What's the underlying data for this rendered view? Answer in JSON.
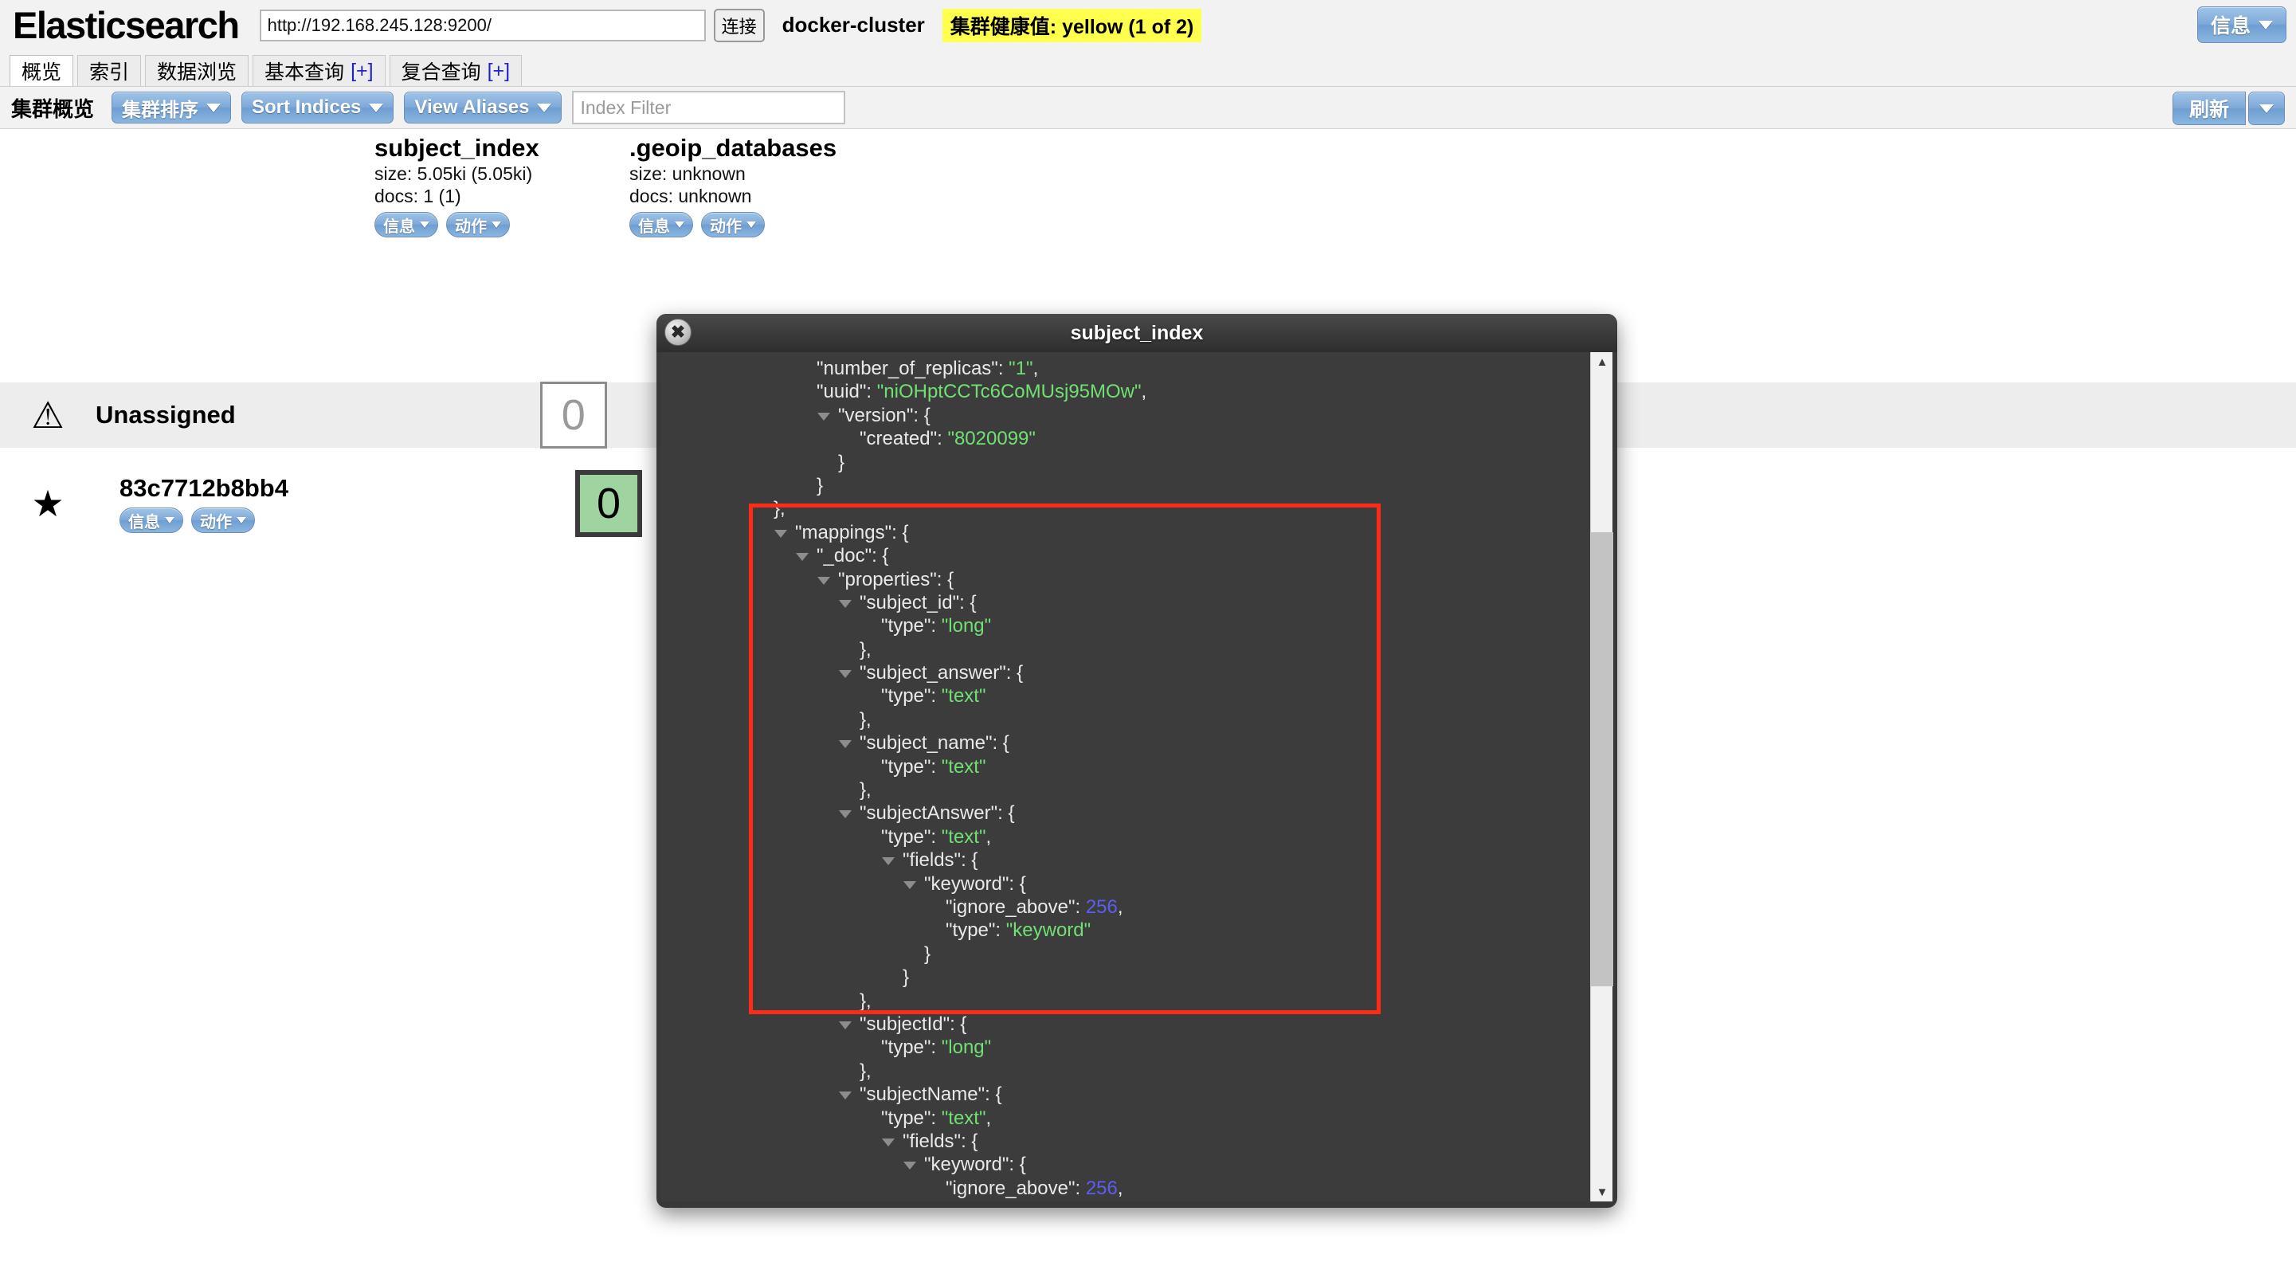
{
  "header": {
    "app_title": "Elasticsearch",
    "cluster_url": "http://192.168.245.128:9200/",
    "connect_label": "连接",
    "cluster_name": "docker-cluster",
    "health_badge": "集群健康值: yellow (1 of 2)",
    "info_button": "信息"
  },
  "tabs": [
    {
      "label": "概览",
      "plus": "",
      "active": true
    },
    {
      "label": "索引",
      "plus": "",
      "active": false
    },
    {
      "label": "数据浏览",
      "plus": "",
      "active": false
    },
    {
      "label": "基本查询",
      "plus": "[+]",
      "active": false
    },
    {
      "label": "复合查询",
      "plus": "[+]",
      "active": false
    }
  ],
  "toolbar": {
    "overview_label": "集群概览",
    "sort_cluster_label": "集群排序",
    "sort_indices_label": "Sort Indices",
    "view_aliases_label": "View Aliases",
    "index_filter_placeholder": "Index Filter",
    "refresh_label": "刷新"
  },
  "indices": [
    {
      "name": "subject_index",
      "size": "size: 5.05ki (5.05ki)",
      "docs": "docs: 1 (1)",
      "info_label": "信息",
      "action_label": "动作"
    },
    {
      "name": ".geoip_databases",
      "size": "size: unknown",
      "docs": "docs: unknown",
      "info_label": "信息",
      "action_label": "动作"
    }
  ],
  "nodes": [
    {
      "icon": "warning-icon",
      "glyph": "⚠",
      "label": "Unassigned",
      "shard": "0"
    },
    {
      "icon": "star-icon",
      "glyph": "★",
      "label": "83c7712b8bb4",
      "shard": "0",
      "info_label": "信息",
      "action_label": "动作"
    }
  ],
  "modal": {
    "title": "subject_index",
    "close_label": "✖",
    "scroll_up": "▲",
    "scroll_down": "▼",
    "json_lines": [
      {
        "indent": 5,
        "tri": false,
        "text": "\"number_of_replicas\": ",
        "value": "\"1\"",
        "value_type": "s",
        "suffix": ","
      },
      {
        "indent": 5,
        "tri": false,
        "text": "\"uuid\": ",
        "value": "\"niOHptCCTc6CoMUsj95MOw\"",
        "value_type": "s",
        "suffix": ","
      },
      {
        "indent": 6,
        "tri": true,
        "text": "\"version\": {",
        "value": "",
        "value_type": "",
        "suffix": ""
      },
      {
        "indent": 7,
        "tri": false,
        "text": "\"created\": ",
        "value": "\"8020099\"",
        "value_type": "s",
        "suffix": ""
      },
      {
        "indent": 6,
        "tri": false,
        "text": "}",
        "value": "",
        "value_type": "",
        "suffix": ""
      },
      {
        "indent": 5,
        "tri": false,
        "text": "}",
        "value": "",
        "value_type": "",
        "suffix": ""
      },
      {
        "indent": 3,
        "tri": false,
        "text": "},",
        "value": "",
        "value_type": "",
        "suffix": ""
      },
      {
        "indent": 4,
        "tri": true,
        "text": "\"mappings\": {",
        "value": "",
        "value_type": "",
        "suffix": ""
      },
      {
        "indent": 5,
        "tri": true,
        "text": "\"_doc\": {",
        "value": "",
        "value_type": "",
        "suffix": ""
      },
      {
        "indent": 6,
        "tri": true,
        "text": "\"properties\": {",
        "value": "",
        "value_type": "",
        "suffix": ""
      },
      {
        "indent": 7,
        "tri": true,
        "text": "\"subject_id\": {",
        "value": "",
        "value_type": "",
        "suffix": ""
      },
      {
        "indent": 8,
        "tri": false,
        "text": "\"type\": ",
        "value": "\"long\"",
        "value_type": "s",
        "suffix": ""
      },
      {
        "indent": 7,
        "tri": false,
        "text": "},",
        "value": "",
        "value_type": "",
        "suffix": ""
      },
      {
        "indent": 7,
        "tri": true,
        "text": "\"subject_answer\": {",
        "value": "",
        "value_type": "",
        "suffix": ""
      },
      {
        "indent": 8,
        "tri": false,
        "text": "\"type\": ",
        "value": "\"text\"",
        "value_type": "s",
        "suffix": ""
      },
      {
        "indent": 7,
        "tri": false,
        "text": "},",
        "value": "",
        "value_type": "",
        "suffix": ""
      },
      {
        "indent": 7,
        "tri": true,
        "text": "\"subject_name\": {",
        "value": "",
        "value_type": "",
        "suffix": ""
      },
      {
        "indent": 8,
        "tri": false,
        "text": "\"type\": ",
        "value": "\"text\"",
        "value_type": "s",
        "suffix": ""
      },
      {
        "indent": 7,
        "tri": false,
        "text": "},",
        "value": "",
        "value_type": "",
        "suffix": ""
      },
      {
        "indent": 7,
        "tri": true,
        "text": "\"subjectAnswer\": {",
        "value": "",
        "value_type": "",
        "suffix": ""
      },
      {
        "indent": 8,
        "tri": false,
        "text": "\"type\": ",
        "value": "\"text\"",
        "value_type": "s",
        "suffix": ","
      },
      {
        "indent": 9,
        "tri": true,
        "text": "\"fields\": {",
        "value": "",
        "value_type": "",
        "suffix": ""
      },
      {
        "indent": 10,
        "tri": true,
        "text": "\"keyword\": {",
        "value": "",
        "value_type": "",
        "suffix": ""
      },
      {
        "indent": 11,
        "tri": false,
        "text": "\"ignore_above\": ",
        "value": "256",
        "value_type": "n",
        "suffix": ","
      },
      {
        "indent": 11,
        "tri": false,
        "text": "\"type\": ",
        "value": "\"keyword\"",
        "value_type": "s",
        "suffix": ""
      },
      {
        "indent": 10,
        "tri": false,
        "text": "}",
        "value": "",
        "value_type": "",
        "suffix": ""
      },
      {
        "indent": 9,
        "tri": false,
        "text": "}",
        "value": "",
        "value_type": "",
        "suffix": ""
      },
      {
        "indent": 7,
        "tri": false,
        "text": "},",
        "value": "",
        "value_type": "",
        "suffix": ""
      },
      {
        "indent": 7,
        "tri": true,
        "text": "\"subjectId\": {",
        "value": "",
        "value_type": "",
        "suffix": ""
      },
      {
        "indent": 8,
        "tri": false,
        "text": "\"type\": ",
        "value": "\"long\"",
        "value_type": "s",
        "suffix": ""
      },
      {
        "indent": 7,
        "tri": false,
        "text": "},",
        "value": "",
        "value_type": "",
        "suffix": ""
      },
      {
        "indent": 7,
        "tri": true,
        "text": "\"subjectName\": {",
        "value": "",
        "value_type": "",
        "suffix": ""
      },
      {
        "indent": 8,
        "tri": false,
        "text": "\"type\": ",
        "value": "\"text\"",
        "value_type": "s",
        "suffix": ","
      },
      {
        "indent": 9,
        "tri": true,
        "text": "\"fields\": {",
        "value": "",
        "value_type": "",
        "suffix": ""
      },
      {
        "indent": 10,
        "tri": true,
        "text": "\"keyword\": {",
        "value": "",
        "value_type": "",
        "suffix": ""
      },
      {
        "indent": 11,
        "tri": false,
        "text": "\"ignore_above\": ",
        "value": "256",
        "value_type": "n",
        "suffix": ","
      }
    ]
  },
  "annotation": {
    "color": "#ff2b16"
  }
}
